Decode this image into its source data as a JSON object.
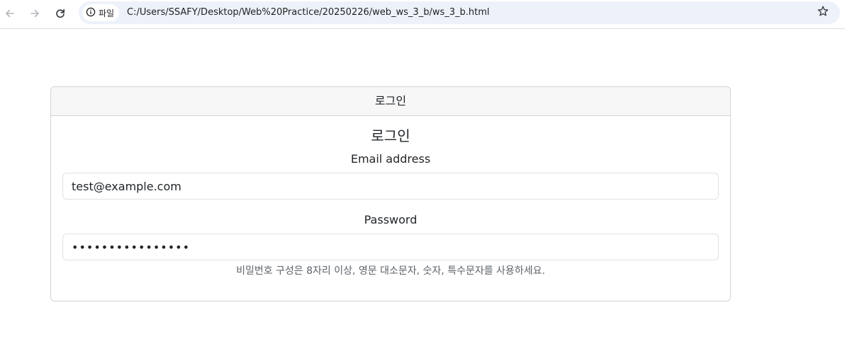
{
  "browser": {
    "back_icon": "arrow-left-icon",
    "forward_icon": "arrow-right-icon",
    "reload_icon": "reload-icon",
    "site_info_icon": "info-circle-icon",
    "site_chip_label": "파일",
    "url": "C:/Users/SSAFY/Desktop/Web%20Practice/20250226/web_ws_3_b/ws_3_b.html",
    "bookmark_icon": "star-outline-icon"
  },
  "card": {
    "header": "로그인",
    "title": "로그인",
    "email": {
      "label": "Email address",
      "value": "test@example.com"
    },
    "password": {
      "label": "Password",
      "value": "abcdefghijklmnop"
    },
    "help_text": "비밀번호 구성은 8자리 이상, 영문 대소문자, 숫자, 특수문자를 사용하세요."
  },
  "colors": {
    "omnibox_bg": "#edf2fa",
    "card_header_bg": "#f7f7f7",
    "border": "#d3d3d3",
    "help_text": "#5c636a"
  }
}
